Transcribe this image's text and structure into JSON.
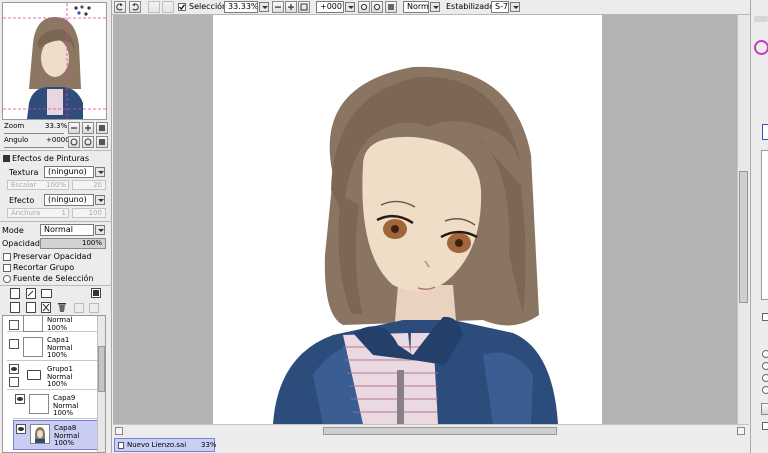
{
  "toolbar": {
    "selection_label": "Selección",
    "zoom_value": "33.33%",
    "rotation_value": "+000°",
    "blend_mode": "Normal",
    "stabilizer_label": "Estabilizador",
    "stabilizer_value": "S-7"
  },
  "navigator": {
    "zoom_label": "Zoom",
    "zoom_value": "33.3%",
    "angle_label": "Angulo",
    "angle_value": "+0000"
  },
  "paint_effects": {
    "header": "Efectos de Pinturas",
    "texture_label": "Textura",
    "texture_value": "(ninguno)",
    "scale_label": "Escalar",
    "scale_value": "100%",
    "scale_num": "20",
    "effect_label": "Efecto",
    "effect_value": "(ninguno)",
    "width_label": "Anchura",
    "width_value": "1",
    "width_num": "100"
  },
  "layer_props": {
    "mode_label": "Mode",
    "mode_value": "Normal",
    "opacity_label": "Opacidad",
    "opacity_value": "100%",
    "opacity_fraction": 1.0,
    "preserve_opacity": "Preservar Opacidad",
    "clip_group": "Recortar Grupo",
    "selection_source": "Fuente de Selección"
  },
  "layers": [
    {
      "name": "",
      "mode": "Normal",
      "opacity": "100%"
    },
    {
      "name": "Capa1",
      "mode": "Normal",
      "opacity": "100%"
    },
    {
      "name": "Grupo1",
      "mode": "Normal",
      "opacity": "100%"
    },
    {
      "name": "Capa9",
      "mode": "Normal",
      "opacity": "100%"
    },
    {
      "name": "Capa8",
      "mode": "Normal",
      "opacity": "100%"
    }
  ],
  "status": {
    "document_name": "Nuevo Lienzo.sai",
    "document_zoom": "33%"
  },
  "colors": {
    "workspace_bg": "#b3b3b3",
    "selected_layer": "#c9cdf4",
    "accent": "#3b4fc8"
  }
}
